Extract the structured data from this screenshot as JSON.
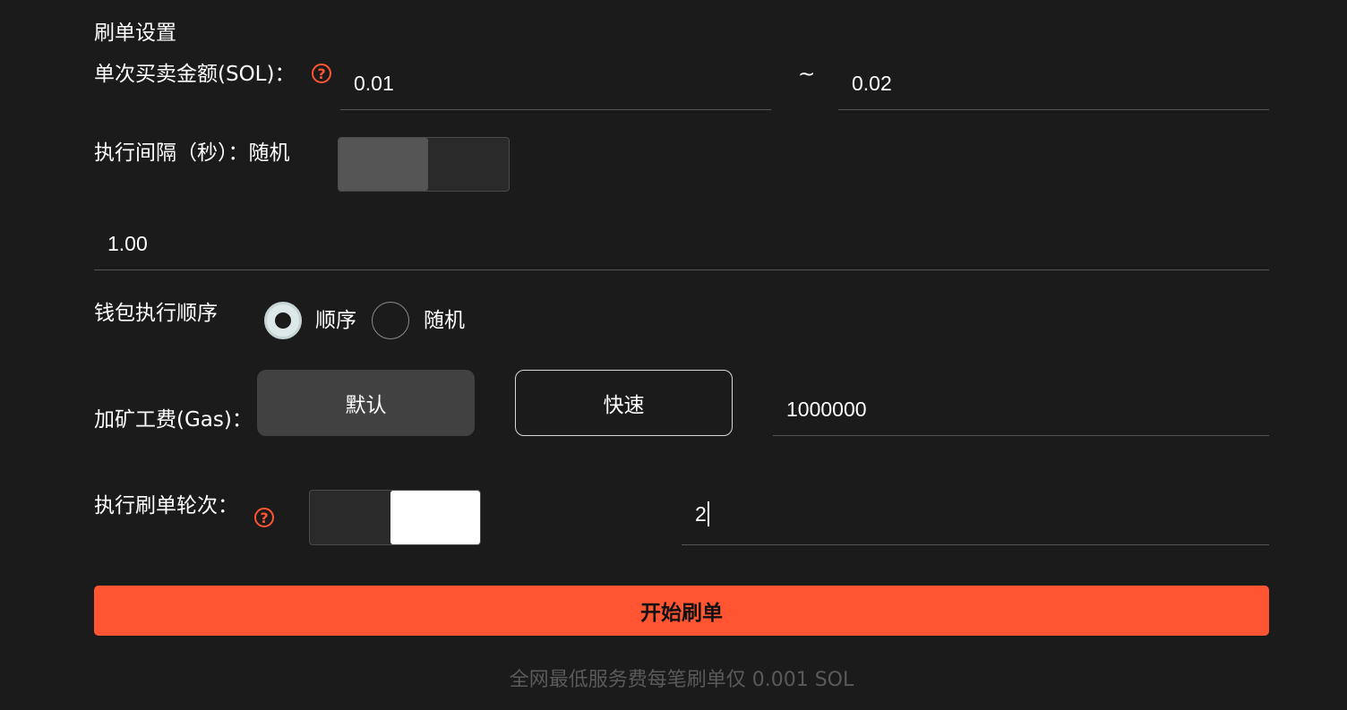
{
  "section_title": "刷单设置",
  "amount": {
    "label": "单次买卖金额(SOL)：",
    "help": "?",
    "min": "0.01",
    "separator": "~",
    "max": "0.02"
  },
  "interval": {
    "label": "执行间隔（秒）：",
    "random_label": "随机",
    "random_enabled": false,
    "value": "1.00"
  },
  "wallet_order": {
    "label": "钱包执行顺序",
    "options": [
      "顺序",
      "随机"
    ],
    "selected": "顺序"
  },
  "gas": {
    "label": "加矿工费(Gas)：",
    "default_label": "默认",
    "fast_label": "快速",
    "selected": "默认",
    "value": "1000000"
  },
  "rounds": {
    "label": "执行刷单轮次：",
    "help": "?",
    "toggle_enabled": true,
    "value": "2"
  },
  "start_button": "开始刷单",
  "footer_text": "全网最低服务费每笔刷单仅 0.001 SOL",
  "colors": {
    "accent": "#ff5533",
    "background": "#1b1b1b"
  }
}
